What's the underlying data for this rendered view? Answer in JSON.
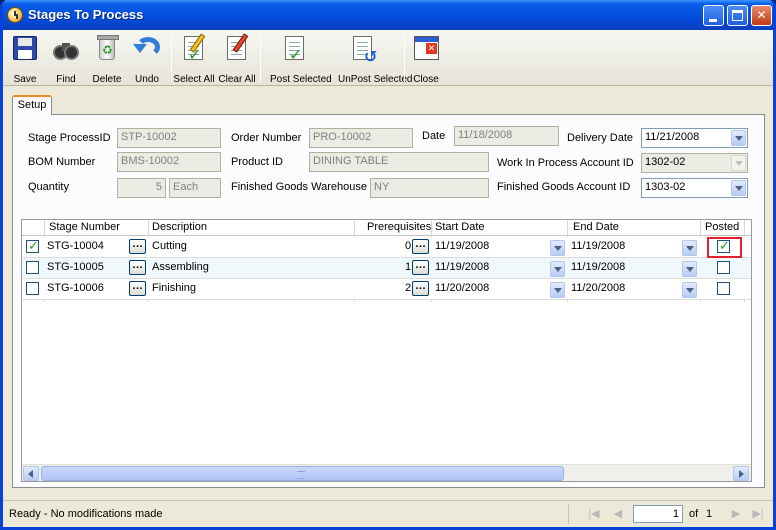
{
  "window": {
    "title": "Stages To Process"
  },
  "toolbar": {
    "save": "Save",
    "find": "Find",
    "delete": "Delete",
    "undo": "Undo",
    "select_all": "Select All",
    "clear_all": "Clear All",
    "post_selected": "Post Selected",
    "unpost_selected": "UnPost Selected",
    "close": "Close"
  },
  "tab": {
    "setup": "Setup"
  },
  "form": {
    "stage_process_id_label": "Stage ProcessID",
    "stage_process_id": "STP-10002",
    "order_number_label": "Order Number",
    "order_number": "PRO-10002",
    "date_label": "Date",
    "date": "11/18/2008",
    "delivery_date_label": "Delivery Date",
    "delivery_date": "11/21/2008",
    "bom_number_label": "BOM Number",
    "bom_number": "BMS-10002",
    "product_id_label": "Product ID",
    "product_id": "DINING TABLE",
    "wip_account_label": "Work In Process Account ID",
    "wip_account": "1302-02",
    "quantity_label": "Quantity",
    "quantity": "5",
    "quantity_unit": "Each",
    "fg_warehouse_label": "Finished Goods Warehouse",
    "fg_warehouse": "NY",
    "fg_account_label": "Finished Goods Account ID",
    "fg_account": "1303-02"
  },
  "grid": {
    "columns": {
      "stage_number": "Stage Number",
      "description": "Description",
      "prerequisites": "Prerequisites",
      "start_date": "Start Date",
      "end_date": "End Date",
      "posted": "Posted"
    },
    "rows": [
      {
        "selected": true,
        "stage_number": "STG-10004",
        "description": "Cutting",
        "prerequisites": "0",
        "start_date": "11/19/2008",
        "end_date": "11/19/2008",
        "posted": true
      },
      {
        "selected": false,
        "stage_number": "STG-10005",
        "description": "Assembling",
        "prerequisites": "1",
        "start_date": "11/19/2008",
        "end_date": "11/19/2008",
        "posted": false
      },
      {
        "selected": false,
        "stage_number": "STG-10006",
        "description": "Finishing",
        "prerequisites": "2",
        "start_date": "11/20/2008",
        "end_date": "11/20/2008",
        "posted": false
      }
    ]
  },
  "status": {
    "message": "Ready - No modifications made",
    "page": "1",
    "of": "of",
    "total": "1"
  },
  "colors": {
    "title_bar": "#0353e0",
    "tab_accent": "#e68b2c",
    "highlight": "#e0202a",
    "check": "#21a121"
  }
}
